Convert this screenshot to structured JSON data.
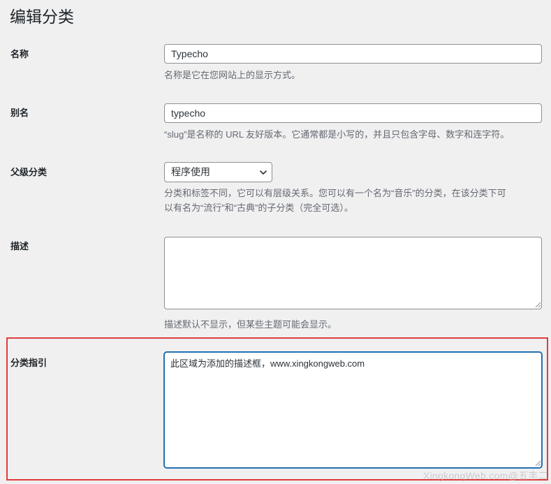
{
  "page": {
    "title": "编辑分类"
  },
  "fields": {
    "name": {
      "label": "名称",
      "value": "Typecho",
      "description": "名称是它在您网站上的显示方式。"
    },
    "slug": {
      "label": "别名",
      "value": "typecho",
      "description": "“slug”是名称的 URL 友好版本。它通常都是小写的，并且只包含字母、数字和连字符。"
    },
    "parent": {
      "label": "父级分类",
      "selected": "程序使用",
      "description_line1": "分类和标签不同，它可以有层级关系。您可以有一个名为“音乐”的分类，在该分类下可",
      "description_line2": "以有名为“流行”和“古典”的子分类（完全可选）。"
    },
    "description": {
      "label": "描述",
      "value": "",
      "description": "描述默认不显示，但某些主题可能会显示。"
    },
    "category_guide": {
      "label": "分类指引",
      "value": "此区域为添加的描述框，www.xingkongweb.com"
    }
  },
  "watermark": "XingkongWeb.com@五丰二",
  "colors": {
    "background": "#f0f0f1",
    "focus": "#2271b1",
    "highlight": "#e03b3b",
    "border": "#8c8f94"
  },
  "icons": {
    "select": "chevron-down-icon",
    "resize": "resize-grip-icon"
  }
}
